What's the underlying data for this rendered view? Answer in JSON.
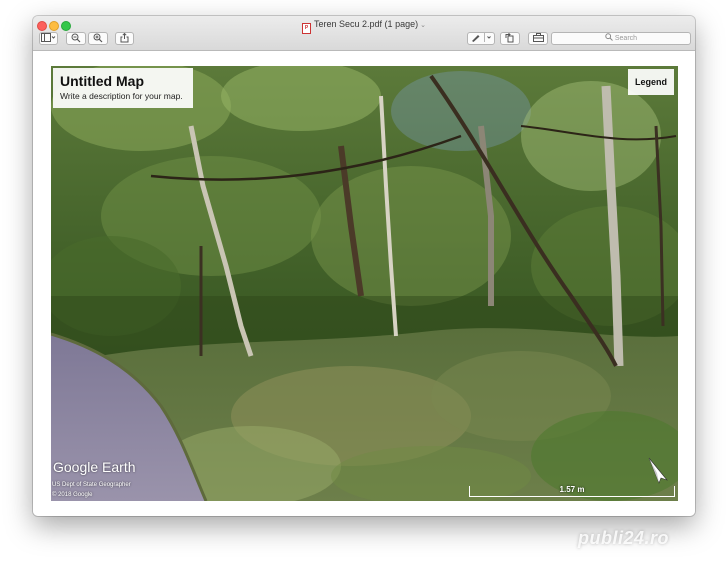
{
  "window": {
    "title": "Teren Secu 2.pdf (1 page)",
    "title_chevron_icon": "chevron-down-icon"
  },
  "toolbar": {
    "sidebar_toggle_icon": "sidebar-icon",
    "zoom_out_icon": "zoom-out-icon",
    "zoom_in_icon": "zoom-in-icon",
    "share_icon": "share-icon",
    "markup_icon": "pen-icon",
    "rotate_icon": "rotate-icon",
    "toolbox_icon": "toolbox-icon",
    "search_placeholder": "Search"
  },
  "map": {
    "title": "Untitled Map",
    "description": "Write a description for your map.",
    "legend_label": "Legend",
    "logo_text": "Google Earth",
    "attribution_line1": "US Dept of State Geographer",
    "attribution_line2": "© 2018 Google",
    "scale_label": "1.57 m",
    "compass_icon": "north-arrow-icon"
  },
  "watermark": "publi24.ro"
}
